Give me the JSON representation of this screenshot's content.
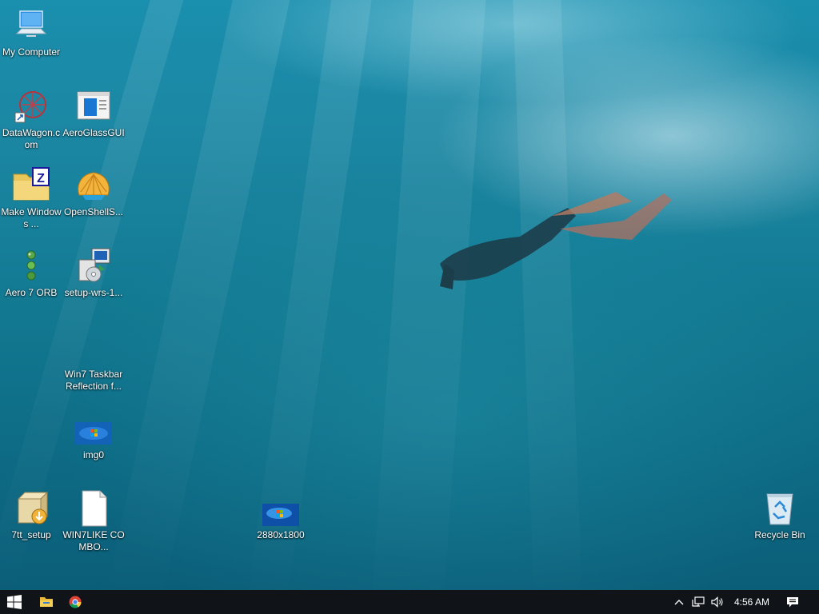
{
  "desktop": {
    "icons": [
      {
        "id": "my-computer",
        "label": "My Computer"
      },
      {
        "id": "datawagon",
        "label": "DataWagon.com"
      },
      {
        "id": "aeroglassgui",
        "label": "AeroGlassGUI"
      },
      {
        "id": "make-windows",
        "label": "Make Windows ..."
      },
      {
        "id": "openshell",
        "label": "OpenShellS..."
      },
      {
        "id": "aero7orb",
        "label": "Aero 7 ORB"
      },
      {
        "id": "setup-wrs",
        "label": "setup-wrs-1..."
      },
      {
        "id": "win7-taskbar",
        "label": "Win7 Taskbar Reflection f..."
      },
      {
        "id": "img0",
        "label": "img0"
      },
      {
        "id": "7tt-setup",
        "label": "7tt_setup"
      },
      {
        "id": "win7like",
        "label": "WIN7LIKE COMBO..."
      },
      {
        "id": "2880x1800",
        "label": "2880x1800"
      },
      {
        "id": "recycle-bin",
        "label": "Recycle Bin"
      }
    ]
  },
  "taskbar": {
    "start_icon": "windows-logo-icon",
    "pinned": [
      {
        "id": "file-explorer",
        "icon": "folder-icon"
      },
      {
        "id": "chrome",
        "icon": "chrome-icon"
      }
    ],
    "tray": {
      "clock": "4:56 AM",
      "icons": [
        "chevron-up-icon",
        "network-icon",
        "volume-icon",
        "notification-icon"
      ]
    }
  },
  "colors": {
    "taskbar_bg": "#101418",
    "wallpaper_top": "#1a8fae",
    "wallpaper_bottom": "#0b5e78"
  }
}
